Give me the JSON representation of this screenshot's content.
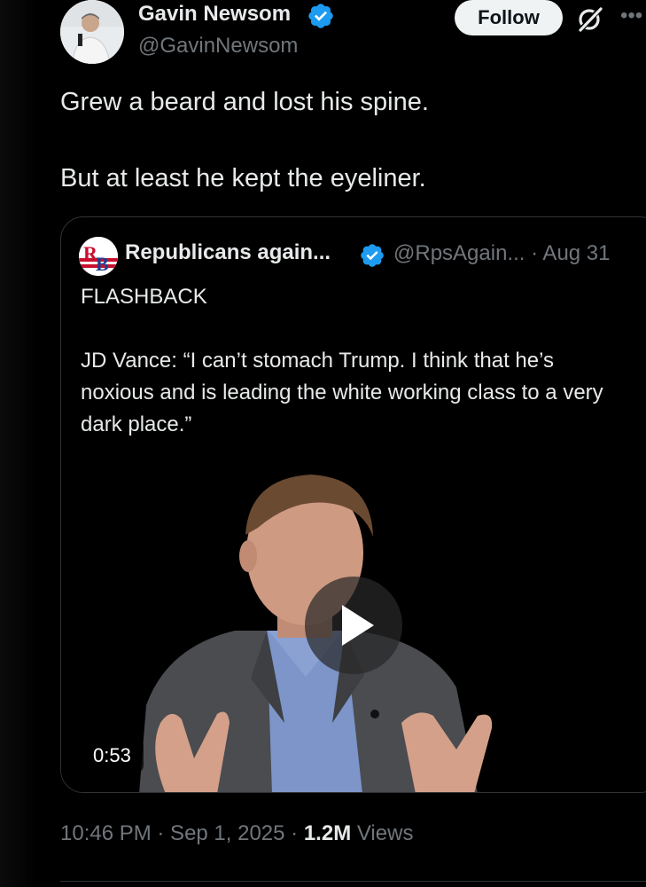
{
  "tweet": {
    "author_name": "Gavin Newsom",
    "author_handle": "@GavinNewsom",
    "follow_label": "Follow",
    "text_lines": [
      "Grew a beard and lost his spine.",
      "But at least he kept the eyeliner."
    ],
    "timestamp": "10:46 PM · Sep 1, 2025 · ",
    "views_count": "1.2M",
    "views_label": " Views"
  },
  "quote": {
    "author_name": "Republicans again...",
    "author_handle": "@RpsAgain... · Aug 31",
    "avatar_initials": "RB",
    "text_lines": [
      "FLASHBACK",
      "JD Vance: “I can’t stomach Trump. I think that he’s noxious and is leading the white working class to a very dark place.”"
    ],
    "video_duration": "0:53"
  },
  "icons": {
    "verified": "verified-badge-icon",
    "grok": "grok-icon",
    "more": "more-icon",
    "play": "play-icon"
  },
  "colors": {
    "background": "#000000",
    "text_primary": "#e7e9ea",
    "text_secondary": "#71767b",
    "verified_blue": "#1d9bf0",
    "follow_bg": "#eff3f4",
    "border": "#2f3336"
  }
}
